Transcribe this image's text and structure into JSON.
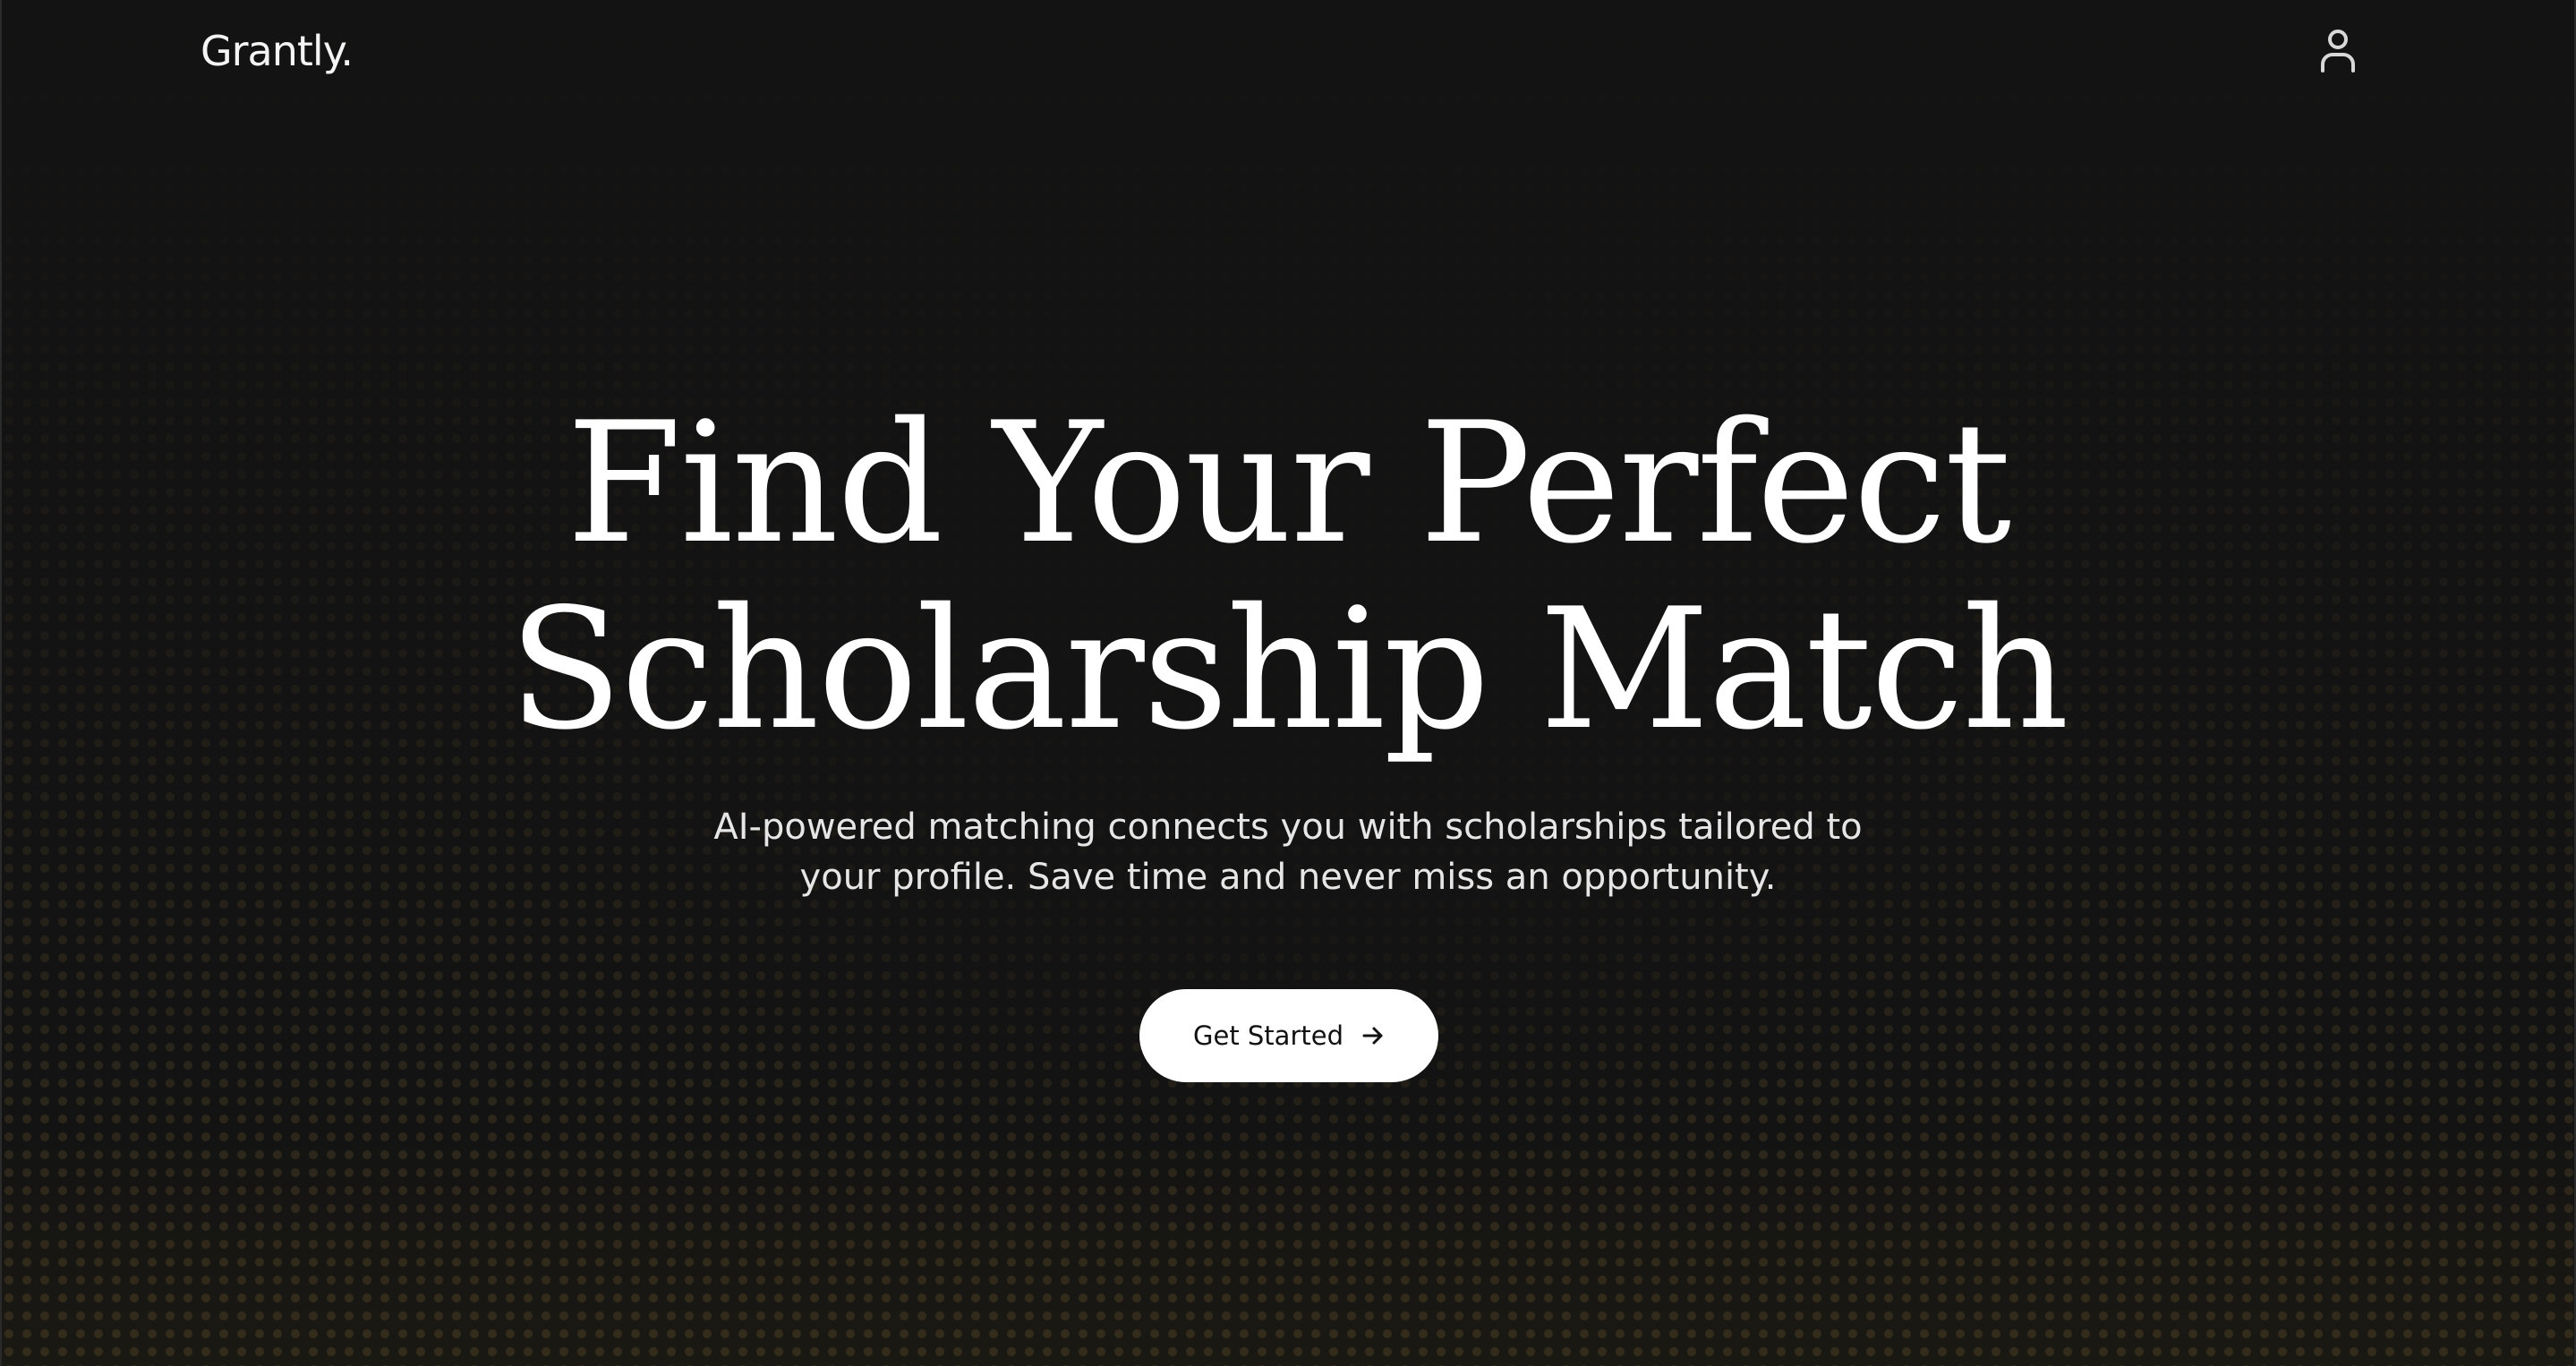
{
  "brand": {
    "logo_text": "Grantly."
  },
  "header": {
    "account_icon": "user-icon"
  },
  "hero": {
    "title_line1": "Find Your Perfect",
    "title_line2": "Scholarship Match",
    "subtitle_line1": "AI-powered matching connects you with scholarships tailored to",
    "subtitle_line2": "your profile. Save time and never miss an opportunity.",
    "cta_label": "Get Started",
    "cta_icon": "arrow-right-icon"
  },
  "colors": {
    "background": "#131313",
    "text": "#ffffff",
    "button_bg": "#ffffff",
    "button_text": "#111111",
    "dot_accent": "#96783c"
  }
}
